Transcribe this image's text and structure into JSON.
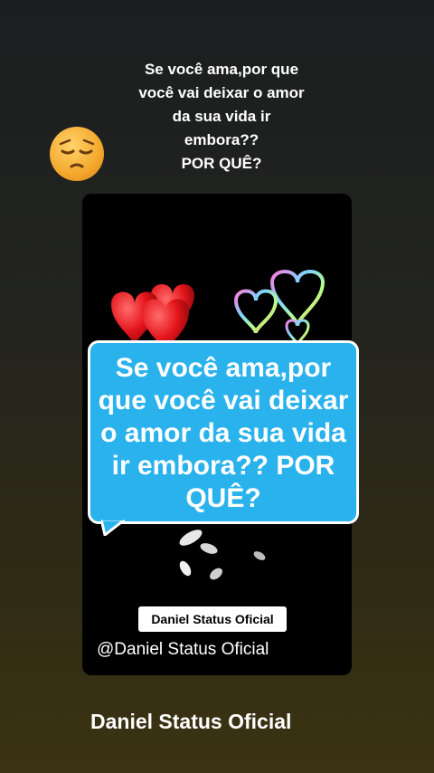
{
  "caption": {
    "line1": "Se você ama,por que",
    "line2": "você vai deixar o amor",
    "line3": "da sua vida ir",
    "line4": "embora??",
    "line5": "POR QUÊ?"
  },
  "emoji": "pensive-face-icon",
  "video": {
    "bubble": {
      "line1": "Se você ama,por",
      "line2": "que você vai deixar",
      "line3": "o amor da sua vida",
      "line4": "ir embora?? POR",
      "line5": "QUÊ?"
    },
    "name_tag": "Daniel Status Oficial",
    "watermark": "@Daniel Status Oficial",
    "icons": [
      "red-hearts-icon",
      "bubble-hearts-icon",
      "feathers-icon"
    ]
  },
  "author_name": "Daniel Status Oficial",
  "colors": {
    "bubble": "#29b2ec",
    "card_background": "#000000"
  }
}
